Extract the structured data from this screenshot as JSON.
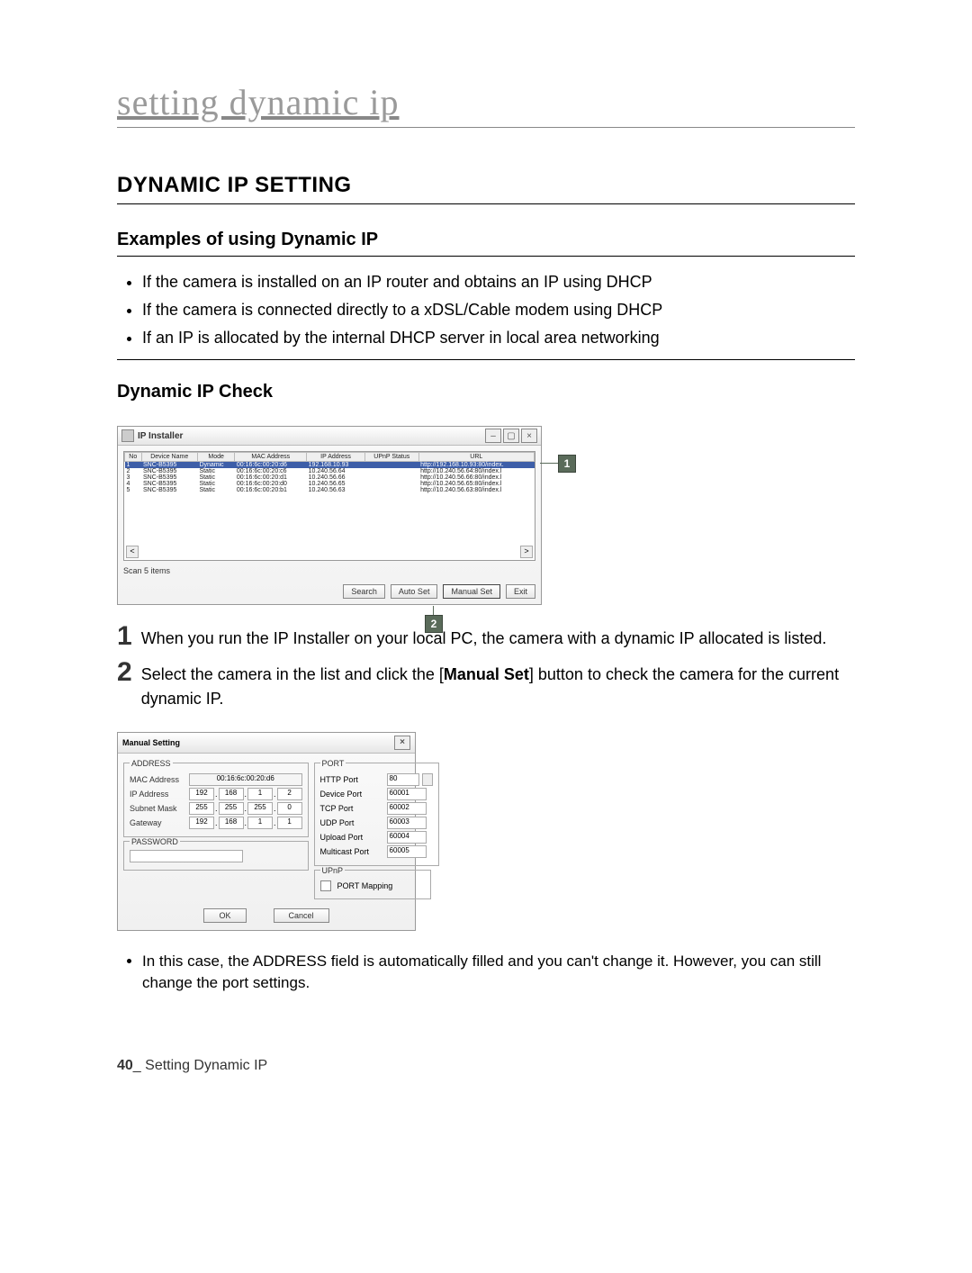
{
  "chapter_title": "setting dynamic ip",
  "section_title": "DYNAMIC IP SETTING",
  "sub_examples": "Examples of using Dynamic IP",
  "bullets": {
    "b1": "If the camera is installed on an IP router and obtains an IP using DHCP",
    "b2": "If the camera is connected directly to a xDSL/Cable modem using DHCP",
    "b3": "If an IP is allocated by the internal DHCP server in local area networking"
  },
  "sub_check": "Dynamic IP Check",
  "ipinstaller": {
    "title": "IP Installer",
    "columns": {
      "no": "No",
      "name": "Device Name",
      "mode": "Mode",
      "mac": "MAC Address",
      "ip": "IP Address",
      "upnp": "UPnP Status",
      "url": "URL"
    },
    "rows": [
      {
        "no": "1",
        "name": "SNC-B5395",
        "mode": "Dynamic",
        "mac": "00:16:6c:00:20:d6",
        "ip": "192.168.10.93",
        "url": "http://192.168.10.93:80/index."
      },
      {
        "no": "2",
        "name": "SNC-B5395",
        "mode": "Static",
        "mac": "00:16:6c:00:20:c6",
        "ip": "10.240.56.64",
        "url": "http://10.240.56.64:80/index.l"
      },
      {
        "no": "3",
        "name": "SNC-B5395",
        "mode": "Static",
        "mac": "00:16:6c:00:20:d1",
        "ip": "10.240.56.66",
        "url": "http://10.240.56.66:80/index.l"
      },
      {
        "no": "4",
        "name": "SNC-B5395",
        "mode": "Static",
        "mac": "00:16:6c:00:20:d0",
        "ip": "10.240.56.65",
        "url": "http://10.240.56.65:80/index.l"
      },
      {
        "no": "5",
        "name": "SNC-B5395",
        "mode": "Static",
        "mac": "00:16:6c:00:20:b1",
        "ip": "10.240.56.63",
        "url": "http://10.240.56.63:80/index.l"
      }
    ],
    "scan": "Scan 5 items",
    "buttons": {
      "search": "Search",
      "autoset": "Auto Set",
      "manualset": "Manual Set",
      "exit": "Exit"
    }
  },
  "callouts": {
    "one": "1",
    "two": "2"
  },
  "steps": {
    "s1_num": "1",
    "s1_text_a": "When you run the IP Installer on your local PC, the camera with a dynamic IP allocated is listed.",
    "s2_num": "2",
    "s2_text_a": "Select the camera in the list and click the [",
    "s2_bold": "Manual Set",
    "s2_text_b": "] button to check the camera for the current dynamic IP."
  },
  "manual_setting": {
    "title": "Manual Setting",
    "groups": {
      "address": "ADDRESS",
      "port": "PORT",
      "password": "PASSWORD",
      "upnp": "UPnP"
    },
    "labels": {
      "mac": "MAC Address",
      "ip": "IP Address",
      "subnet": "Subnet Mask",
      "gateway": "Gateway",
      "http": "HTTP Port",
      "device": "Device Port",
      "tcp": "TCP Port",
      "udp": "UDP Port",
      "upload": "Upload Port",
      "multicast": "Multicast Port",
      "portmap": "PORT Mapping"
    },
    "values": {
      "mac": "00:16:6c:00:20:d6",
      "ip": [
        "192",
        "168",
        "1",
        "2"
      ],
      "subnet": [
        "255",
        "255",
        "255",
        "0"
      ],
      "gateway": [
        "192",
        "168",
        "1",
        "1"
      ],
      "http": "80",
      "device": "60001",
      "tcp": "60002",
      "udp": "60003",
      "upload": "60004",
      "multicast": "60005"
    },
    "buttons": {
      "ok": "OK",
      "cancel": "Cancel"
    }
  },
  "note": {
    "n1": "In this case, the ADDRESS field is automatically filled and you can't change it. However, you can still change the port settings."
  },
  "footer": {
    "pagenum": "40",
    "underscore": "_",
    "text": " Setting Dynamic IP"
  }
}
